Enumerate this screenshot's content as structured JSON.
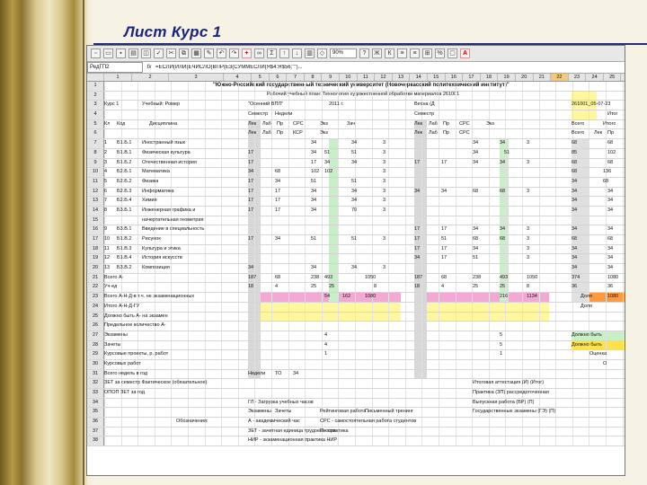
{
  "slide": {
    "title": "Лист Курс 1"
  },
  "app": {
    "zoom": "90%",
    "name_box": "РедГП2",
    "fx": "fx",
    "formula": "=ЕСЛИ(ИЛИ(ЕЧИСЛО(ВПР(ЕЗ(СУММЕСЛИ(Я$4:Я$56;\"\")...",
    "columns": [
      "1",
      "2",
      "3",
      "4",
      "5",
      "6",
      "7",
      "8",
      "9",
      "10",
      "11",
      "12",
      "13",
      "14",
      "15",
      "16",
      "17",
      "18",
      "19",
      "20",
      "21",
      "22",
      "23",
      "24",
      "25",
      "26"
    ],
    "selected_column": "22"
  },
  "header": {
    "university": "\"Южно-Российский государственный технический университет (Новочеркасский политехнический институт)\"",
    "plan": "Рабочий учебный план: Технология художественной обработки материалов 261001",
    "course": "Курс 1",
    "sem1": "\"Осенний ВПЛ\" \" __\" ____ 2011 г.",
    "code": "261001_05-07-23"
  },
  "rows": [
    {
      "n": "1",
      "c": []
    },
    {
      "n": "2",
      "c": []
    },
    {
      "n": "3",
      "c": [
        [
          "Курс 1",
          0
        ],
        [
          "Учебный: Ромер",
          42
        ],
        [
          "\"Осенний ВПЛ\"",
          160
        ],
        [
          "2011 г.",
          250
        ],
        [
          "Весна (Д",
          345
        ],
        [
          "261001_05-07-23",
          520
        ]
      ]
    },
    {
      "n": "4",
      "c": [
        [
          "Семестр",
          160
        ],
        [
          "Недели",
          190
        ],
        [
          "Семестр",
          345
        ],
        [
          "Итог",
          560
        ]
      ]
    },
    {
      "n": "5",
      "c": [
        [
          "Кл",
          0
        ],
        [
          "Код",
          14
        ],
        [
          "Дисциплина",
          50
        ],
        [
          "Лек",
          160
        ],
        [
          "Лаб",
          176
        ],
        [
          "Пр",
          192
        ],
        [
          "СРС",
          210
        ],
        [
          "Экз",
          240
        ],
        [
          "Зач",
          270
        ],
        [
          "Лек",
          345
        ],
        [
          "Лаб",
          361
        ],
        [
          "Пр",
          377
        ],
        [
          "СРС",
          395
        ],
        [
          "Экз",
          425
        ],
        [
          "Всего",
          520
        ],
        [
          "Итого",
          555
        ]
      ]
    },
    {
      "n": "6",
      "c": [
        [
          "Лек",
          160
        ],
        [
          "Лаб",
          176
        ],
        [
          "Пр",
          192
        ],
        [
          "КСР",
          210
        ],
        [
          "Экз",
          240
        ],
        [
          "Лек",
          345
        ],
        [
          "Лаб",
          361
        ],
        [
          "Пр",
          377
        ],
        [
          "СРС",
          395
        ],
        [
          "Всего",
          520
        ],
        [
          "Лек",
          545
        ],
        [
          "Пр",
          560
        ]
      ]
    },
    {
      "n": "7",
      "c": [
        [
          "1",
          0
        ],
        [
          "Б1.Б.1",
          14
        ],
        [
          "Иностранный язык",
          42
        ],
        [
          "34",
          230
        ],
        [
          "34",
          275
        ],
        [
          "3",
          310
        ],
        [
          "34",
          410
        ],
        [
          "34",
          440
        ],
        [
          "3",
          470
        ],
        [
          "68",
          520
        ],
        [
          "68",
          560
        ]
      ]
    },
    {
      "n": "8",
      "c": [
        [
          "2",
          0
        ],
        [
          "Б1.В.1",
          14
        ],
        [
          "Физическая культура",
          42
        ],
        [
          "17",
          160
        ],
        [
          "34",
          230
        ],
        [
          "51",
          245
        ],
        [
          "51",
          275
        ],
        [
          "3",
          310
        ],
        [
          "34",
          410
        ],
        [
          "51",
          445
        ],
        [
          "85",
          520
        ],
        [
          "102",
          560
        ]
      ]
    },
    {
      "n": "9",
      "c": [
        [
          "3",
          0
        ],
        [
          "Б1.Б.2",
          14
        ],
        [
          "Отечественная история",
          42
        ],
        [
          "17",
          160
        ],
        [
          "17",
          230
        ],
        [
          "34",
          245
        ],
        [
          "34",
          275
        ],
        [
          "3",
          310
        ],
        [
          "17",
          345
        ],
        [
          "17",
          375
        ],
        [
          "34",
          410
        ],
        [
          "34",
          440
        ],
        [
          "3",
          470
        ],
        [
          "68",
          520
        ],
        [
          "68",
          560
        ]
      ]
    },
    {
      "n": "10",
      "c": [
        [
          "4",
          0
        ],
        [
          "Б2.Б.1",
          14
        ],
        [
          "Математика",
          42
        ],
        [
          "34",
          160
        ],
        [
          "68",
          190
        ],
        [
          "102",
          230
        ],
        [
          "102",
          245
        ],
        [
          "3",
          310
        ],
        [
          "68",
          520
        ],
        [
          "136",
          555
        ]
      ]
    },
    {
      "n": "11",
      "c": [
        [
          "5",
          0
        ],
        [
          "Б2.Б.2",
          14
        ],
        [
          "Физика",
          42
        ],
        [
          "17",
          160
        ],
        [
          "34",
          190
        ],
        [
          "51",
          230
        ],
        [
          "51",
          275
        ],
        [
          "3",
          310
        ],
        [
          "34",
          520
        ],
        [
          "68",
          555
        ]
      ]
    },
    {
      "n": "12",
      "c": [
        [
          "6",
          0
        ],
        [
          "Б2.Б.3",
          14
        ],
        [
          "Информатика",
          42
        ],
        [
          "17",
          160
        ],
        [
          "17",
          190
        ],
        [
          "34",
          230
        ],
        [
          "34",
          275
        ],
        [
          "3",
          310
        ],
        [
          "34",
          345
        ],
        [
          "34",
          375
        ],
        [
          "68",
          410
        ],
        [
          "68",
          440
        ],
        [
          "3",
          470
        ],
        [
          "34",
          520
        ],
        [
          "34",
          560
        ]
      ]
    },
    {
      "n": "13",
      "c": [
        [
          "7",
          0
        ],
        [
          "Б2.Б.4",
          14
        ],
        [
          "Химия",
          42
        ],
        [
          "17",
          160
        ],
        [
          "17",
          190
        ],
        [
          "34",
          230
        ],
        [
          "34",
          275
        ],
        [
          "3",
          310
        ],
        [
          "34",
          520
        ],
        [
          "34",
          560
        ]
      ]
    },
    {
      "n": "14",
      "c": [
        [
          "8",
          0
        ],
        [
          "Б3.Б.1",
          14
        ],
        [
          "Инженерная графика и",
          42
        ],
        [
          "17",
          160
        ],
        [
          "17",
          190
        ],
        [
          "34",
          230
        ],
        [
          "70",
          275
        ],
        [
          "3",
          310
        ],
        [
          "34",
          520
        ],
        [
          "34",
          560
        ]
      ]
    },
    {
      "n": "15",
      "c": [
        [
          "начертательная геометрия",
          42
        ]
      ]
    },
    {
      "n": "16",
      "c": [
        [
          "9",
          0
        ],
        [
          "Б3.В.1",
          14
        ],
        [
          "Введение в специальность",
          42
        ],
        [
          "17",
          345
        ],
        [
          "17",
          375
        ],
        [
          "34",
          410
        ],
        [
          "34",
          440
        ],
        [
          "3",
          470
        ],
        [
          "34",
          520
        ],
        [
          "34",
          560
        ]
      ]
    },
    {
      "n": "17",
      "c": [
        [
          "10",
          0
        ],
        [
          "Б1.В.2",
          14
        ],
        [
          "Рисунок",
          42
        ],
        [
          "17",
          160
        ],
        [
          "34",
          190
        ],
        [
          "51",
          230
        ],
        [
          "51",
          275
        ],
        [
          "3",
          310
        ],
        [
          "17",
          345
        ],
        [
          "51",
          375
        ],
        [
          "68",
          410
        ],
        [
          "68",
          440
        ],
        [
          "3",
          470
        ],
        [
          "68",
          520
        ],
        [
          "68",
          560
        ]
      ]
    },
    {
      "n": "18",
      "c": [
        [
          "11",
          0
        ],
        [
          "Б1.В.3",
          14
        ],
        [
          "Культура и этика",
          42
        ],
        [
          "17",
          345
        ],
        [
          "17",
          375
        ],
        [
          "34",
          410
        ],
        [
          "3",
          470
        ],
        [
          "34",
          520
        ],
        [
          "34",
          560
        ]
      ]
    },
    {
      "n": "19",
      "c": [
        [
          "12",
          0
        ],
        [
          "Б1.В.4",
          14
        ],
        [
          "История искусств",
          42
        ],
        [
          "34",
          345
        ],
        [
          "17",
          375
        ],
        [
          "51",
          410
        ],
        [
          "3",
          470
        ],
        [
          "34",
          520
        ],
        [
          "34",
          560
        ]
      ]
    },
    {
      "n": "20",
      "c": [
        [
          "13",
          0
        ],
        [
          "Б3.В.2",
          14
        ],
        [
          "Композиция",
          42
        ],
        [
          "34",
          160
        ],
        [
          "34",
          230
        ],
        [
          "34",
          275
        ],
        [
          "3",
          310
        ],
        [
          "34",
          520
        ],
        [
          "34",
          560
        ]
      ]
    },
    {
      "n": "21",
      "c": [
        [
          "Всего А-",
          0
        ],
        [
          "187",
          160
        ],
        [
          "68",
          190
        ],
        [
          "238",
          230
        ],
        [
          "493",
          245
        ],
        [
          "1050",
          290
        ],
        [
          "187",
          345
        ],
        [
          "68",
          375
        ],
        [
          "238",
          410
        ],
        [
          "493",
          440
        ],
        [
          "1050",
          470
        ],
        [
          "374",
          520
        ],
        [
          "1080",
          560
        ]
      ]
    },
    {
      "n": "22",
      "c": [
        [
          "Уч-ед",
          0
        ],
        [
          "18",
          160
        ],
        [
          "4",
          190
        ],
        [
          "25",
          230
        ],
        [
          "25",
          250
        ],
        [
          "8",
          300
        ],
        [
          "18",
          345
        ],
        [
          "4",
          375
        ],
        [
          "25",
          410
        ],
        [
          "25",
          440
        ],
        [
          "8",
          470
        ],
        [
          "36",
          520
        ],
        [
          "36",
          560
        ]
      ]
    },
    {
      "n": "23",
      "c": [
        [
          "Всего А-Н-Д-в т.ч. не экзаменационных",
          0
        ],
        [
          "54",
          245
        ],
        [
          "162",
          265
        ],
        [
          "1080",
          290
        ],
        [
          "216",
          440
        ],
        [
          "1134",
          470
        ],
        [
          "Доля",
          530
        ],
        [
          "1080",
          560
        ]
      ]
    },
    {
      "n": "24",
      "c": [
        [
          "Итого А-Н-Д-ГУ",
          0
        ],
        [
          "Доля",
          530
        ]
      ]
    },
    {
      "n": "25",
      "c": [
        [
          "Должно быть А- на экзамен",
          0
        ]
      ]
    },
    {
      "n": "26",
      "c": [
        [
          "Предельное количество А-",
          0
        ]
      ]
    },
    {
      "n": "27",
      "c": [
        [
          "Экзамены",
          0
        ],
        [
          "4",
          245
        ],
        [
          "5",
          440
        ],
        [
          "Должно быть",
          520
        ]
      ]
    },
    {
      "n": "28",
      "c": [
        [
          "Зачеты",
          0
        ],
        [
          "4",
          245
        ],
        [
          "5",
          440
        ],
        [
          "Должно быть",
          520
        ]
      ]
    },
    {
      "n": "29",
      "c": [
        [
          "Курсовые проекты, р. работ",
          0
        ],
        [
          "1",
          245
        ],
        [
          "1",
          440
        ],
        [
          "Оценка",
          540
        ]
      ]
    },
    {
      "n": "30",
      "c": [
        [
          "Курсовых работ",
          0
        ],
        [
          "О",
          555
        ]
      ]
    },
    {
      "n": "31",
      "c": [
        [
          "Всего недель в год",
          0
        ],
        [
          "Недели",
          160
        ],
        [
          "ТО",
          190
        ],
        [
          "34",
          210
        ]
      ]
    },
    {
      "n": "32",
      "c": [
        [
          "ЗЕТ за семестр Фактическое (обязательное)",
          0
        ],
        [
          "Итоговая аттестация (И) (Итог)",
          410
        ]
      ]
    },
    {
      "n": "33",
      "c": [
        [
          "ОПОП ЗЕТ за год",
          0
        ],
        [
          "Практика (ЗП) рассредоточенная",
          410
        ]
      ]
    },
    {
      "n": "34",
      "c": [
        [
          "ГЛ - Загрузка учебных часов",
          160
        ],
        [
          "Выпускная работа (ВР) (П)",
          410
        ]
      ]
    },
    {
      "n": "35",
      "c": [
        [
          "Экзамены",
          160
        ],
        [
          "Зачеты",
          190
        ],
        [
          "Рейтинговая работа",
          240
        ],
        [
          "Письменный тренинг",
          290
        ],
        [
          "Государственные экзамены (ГЭ) (П)",
          410
        ]
      ]
    },
    {
      "n": "36",
      "c": [
        [
          "Обозначения:",
          80
        ],
        [
          "А - академический час",
          160
        ],
        [
          "СРС - самостоятельная работа студентов",
          240
        ]
      ]
    },
    {
      "n": "37",
      "c": [
        [
          "ЗЕТ - зачетная единица трудоемкости",
          160
        ],
        [
          "П - практика",
          240
        ]
      ]
    },
    {
      "n": "38",
      "c": [
        [
          "НИР - экзаменационная практика НИР",
          160
        ]
      ]
    }
  ]
}
